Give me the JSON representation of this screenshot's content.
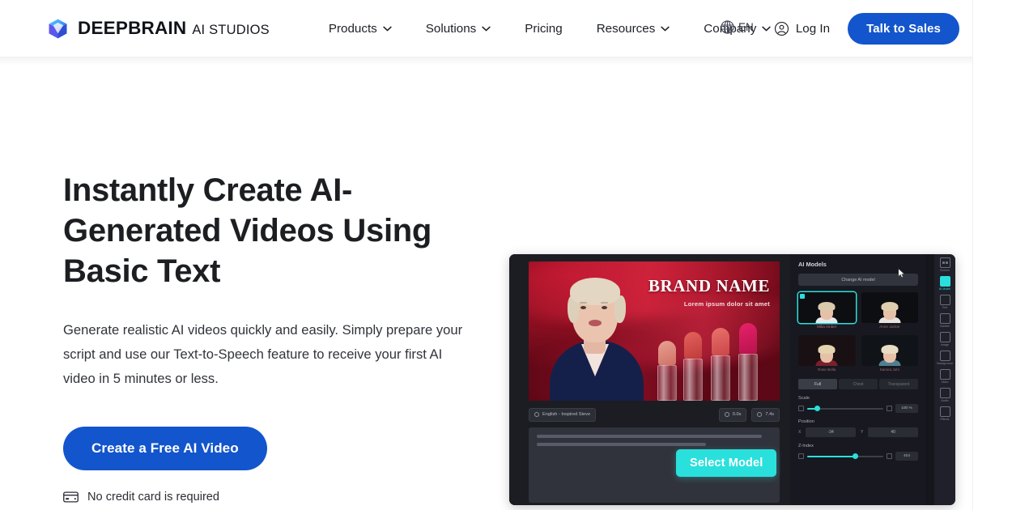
{
  "brand": {
    "logo_icon": "cube-logo-icon",
    "name": "DEEPBRAIN",
    "sub": "AI STUDIOS"
  },
  "nav": {
    "items": [
      {
        "label": "Products",
        "has_chevron": true
      },
      {
        "label": "Solutions",
        "has_chevron": true
      },
      {
        "label": "Pricing",
        "has_chevron": false
      },
      {
        "label": "Resources",
        "has_chevron": true
      },
      {
        "label": "Company",
        "has_chevron": true
      }
    ]
  },
  "header_right": {
    "language": {
      "icon": "globe-icon",
      "label": "EN"
    },
    "login": {
      "icon": "user-circle-icon",
      "label": "Log In"
    },
    "cta": {
      "label": "Talk to Sales",
      "color": "#1355cc"
    }
  },
  "hero": {
    "headline": "Instantly Create AI-Generated Videos Using Basic Text",
    "subcopy": "Generate realistic AI videos quickly and easily. Simply prepare your script and use our Text-to-Speech feature to receive your first AI video in 5 minutes or less.",
    "cta": {
      "label": "Create a Free AI Video",
      "color": "#1355cc"
    },
    "note": {
      "icon": "credit-card-icon",
      "label": "No credit card is required"
    }
  },
  "mock": {
    "stage": {
      "brand_title": "BRAND NAME",
      "brand_tagline": "Lorem ipsum dolor sit amet"
    },
    "toolbar": {
      "language_chip": "English - Inspired Steve",
      "time_chip_1": "0.0s",
      "time_chip_2": "7.4s"
    },
    "select_model_button": {
      "label": "Select Model",
      "color": "#2ae0dc"
    },
    "panel": {
      "title": "AI Models",
      "change_button": "Change AI model",
      "models": [
        {
          "name": "Mika Amber",
          "selected": true
        },
        {
          "name": "Anne Jackie",
          "selected": false
        },
        {
          "name": "Rose Bella",
          "selected": false
        },
        {
          "name": "Samira Juhi",
          "selected": false
        }
      ],
      "segments": [
        {
          "label": "Full",
          "active": true
        },
        {
          "label": "Chest",
          "active": false
        },
        {
          "label": "Transparent",
          "active": false
        }
      ],
      "controls": [
        {
          "label": "Scale",
          "value": "100 %",
          "fill_pct": 12
        },
        {
          "label": "Z-Index",
          "value": "404",
          "fill_pct": 62
        }
      ],
      "position": {
        "label": "Position",
        "x_key": "X",
        "x_value": "-34",
        "y_key": "Y",
        "y_value": "40"
      }
    },
    "rail": [
      {
        "icon": "scenes-icon",
        "label": "Scenes",
        "active": false
      },
      {
        "icon": "ai-model-icon",
        "label": "AI Model",
        "active": true
      },
      {
        "icon": "text-icon",
        "label": "Text",
        "active": false
      },
      {
        "icon": "subtitle-icon",
        "label": "Subtitle",
        "active": false
      },
      {
        "icon": "image-icon",
        "label": "Image",
        "active": false
      },
      {
        "icon": "background-icon",
        "label": "Background",
        "active": false
      },
      {
        "icon": "video-icon",
        "label": "Video",
        "active": false
      },
      {
        "icon": "audio-icon",
        "label": "Audio",
        "active": false
      },
      {
        "icon": "effects-icon",
        "label": "Effects",
        "active": false
      }
    ]
  }
}
